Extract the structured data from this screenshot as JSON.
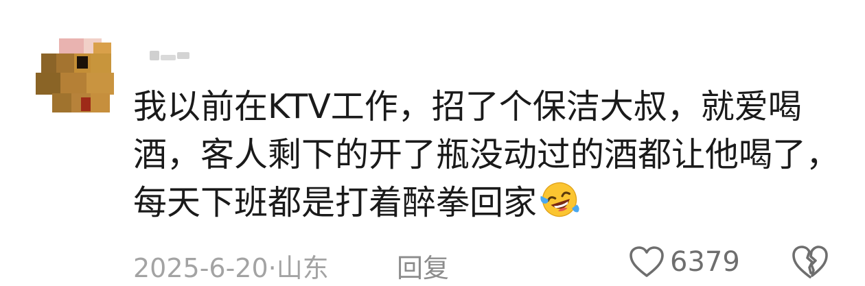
{
  "comment": {
    "lines": [
      "我以前在KTV工作，招了个保洁大叔，就爱喝",
      "酒，客人剩下的开了瓶没动过的酒都让他喝了，",
      "每天下班都是打着醉拳回家"
    ],
    "emoji": "laughing-crying-emoji"
  },
  "meta": {
    "date": "2025-6-20·山东",
    "reply_label": "回复",
    "like_count": "6379",
    "like_icon": "heart-outline-icon",
    "dislike_icon": "broken-heart-icon"
  },
  "colors": {
    "text": "#1a1a1a",
    "meta": "#a3a3a3",
    "reply": "#8c8c8c",
    "count": "#6e6e6e"
  }
}
